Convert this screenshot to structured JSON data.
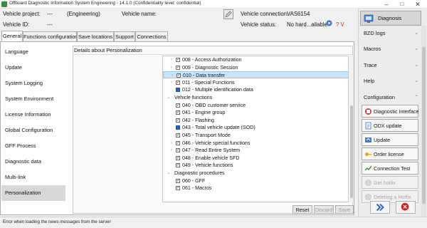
{
  "window": {
    "title": "Offboard Diagnostic Information System Engineering - 14.1.0 (Confidentiality level: confidential)",
    "minimize_icon": "minimize-icon",
    "maximize_icon": "maximize-icon",
    "close_icon": "close-icon"
  },
  "header": {
    "project_label": "Vehicle project:",
    "project_value": "---",
    "engineering_value": "(Engineering)",
    "vehicle_name_label": "Vehicle name:",
    "vehicle_id_label": "Vehicle ID:",
    "vehicle_id_value": "---",
    "connection_label": "Vehicle connection:",
    "connection_value": "VAS6154",
    "status_label": "Vehicle status:",
    "status_value": "No hard...ailable",
    "help_value": "? V",
    "status_color": "#d81e1e"
  },
  "tabs": [
    {
      "label": "General",
      "active": true
    },
    {
      "label": "Functions configuration",
      "active": false
    },
    {
      "label": "Save locations",
      "active": false
    },
    {
      "label": "Support",
      "active": false
    },
    {
      "label": "Connections",
      "active": false
    }
  ],
  "nav": {
    "items": [
      {
        "label": "Language"
      },
      {
        "label": "Update"
      },
      {
        "label": "System Logging"
      },
      {
        "label": "System Environment"
      },
      {
        "label": "License Information"
      },
      {
        "label": "Global Configuration"
      },
      {
        "label": "GFF Process"
      },
      {
        "label": "Diagnostic data"
      },
      {
        "label": "Multi-link"
      },
      {
        "label": "Personalization"
      }
    ],
    "active_index": 9
  },
  "details": {
    "title": "Details about Personalization"
  },
  "tree": {
    "rows": [
      {
        "text": "008 - Access Authorization",
        "level": 2,
        "caret": true,
        "cb": "check",
        "selected": false
      },
      {
        "text": "009 - Diagnostic Session",
        "level": 2,
        "caret": true,
        "cb": "check",
        "selected": false
      },
      {
        "text": "010 - Data transfer",
        "level": 2,
        "caret": true,
        "cb": "check",
        "selected": true
      },
      {
        "text": "011 - Special Functions",
        "level": 2,
        "caret": true,
        "cb": "check",
        "selected": false
      },
      {
        "text": "012 - Multiple identification data",
        "level": 2,
        "caret": false,
        "cb": "square",
        "selected": false
      },
      {
        "text": "Vehicle functions",
        "level": 1,
        "caret": true,
        "cb": "none",
        "selected": false
      },
      {
        "text": "040 - OBD customer service",
        "level": 2,
        "caret": false,
        "cb": "check",
        "selected": false
      },
      {
        "text": "041 - Engine group",
        "level": 2,
        "caret": false,
        "cb": "check",
        "selected": false
      },
      {
        "text": "042 - Flashing",
        "level": 2,
        "caret": false,
        "cb": "check",
        "selected": false
      },
      {
        "text": "043 - Total vehicle update (SOD)",
        "level": 2,
        "caret": false,
        "cb": "square",
        "selected": false
      },
      {
        "text": "045 - Transport Mode",
        "level": 2,
        "caret": false,
        "cb": "check",
        "selected": false
      },
      {
        "text": "046 - Vehicle special functions",
        "level": 2,
        "caret": true,
        "cb": "check",
        "selected": false
      },
      {
        "text": "047 - Read Entire System",
        "level": 2,
        "caret": true,
        "cb": "check",
        "selected": false
      },
      {
        "text": "048 - Enable vehicle SFD",
        "level": 2,
        "caret": false,
        "cb": "check",
        "selected": false
      },
      {
        "text": "049 - Vehicle functions",
        "level": 2,
        "caret": false,
        "cb": "check",
        "selected": false
      },
      {
        "text": "Diagnostic procedures",
        "level": 1,
        "caret": true,
        "cb": "none",
        "selected": false
      },
      {
        "text": "060 - GFF",
        "level": 2,
        "caret": false,
        "cb": "check",
        "selected": false
      },
      {
        "text": "061 - Macros",
        "level": 2,
        "caret": false,
        "cb": "check",
        "selected": false
      }
    ]
  },
  "buttons": {
    "reset": "Reset",
    "discard": "Discard",
    "save": "Save"
  },
  "statusbar": {
    "message": "Error when loading the news messages from the server"
  },
  "sidebar": {
    "diagnosis_label": "Diagnosis",
    "sections": [
      {
        "label": "BZD logs"
      },
      {
        "label": "Macros"
      },
      {
        "label": "Trace"
      },
      {
        "label": "Help"
      },
      {
        "label": "Configuration"
      }
    ],
    "config_buttons": [
      {
        "label": "Diagnostic Interface",
        "icon": "interface-icon",
        "disabled": false
      },
      {
        "label": "ODX update",
        "icon": "document-icon",
        "disabled": false
      },
      {
        "label": "Update",
        "icon": "update-icon",
        "disabled": false
      },
      {
        "label": "Order license",
        "icon": "key-icon",
        "disabled": false
      },
      {
        "label": "Connection Test",
        "icon": "connection-test-icon",
        "disabled": false
      },
      {
        "label": "Get hotfix",
        "icon": "hotfix-icon",
        "disabled": true
      },
      {
        "label": "Deleting a Hotfix",
        "icon": "hotfix-delete-icon",
        "disabled": true
      }
    ],
    "forward_icon": "double-chevron-right-icon",
    "exit_icon": "exit-icon"
  },
  "colors": {
    "accent_blue": "#2a64b8",
    "selection": "#cce4f7",
    "exit_red": "#d81e1e"
  }
}
